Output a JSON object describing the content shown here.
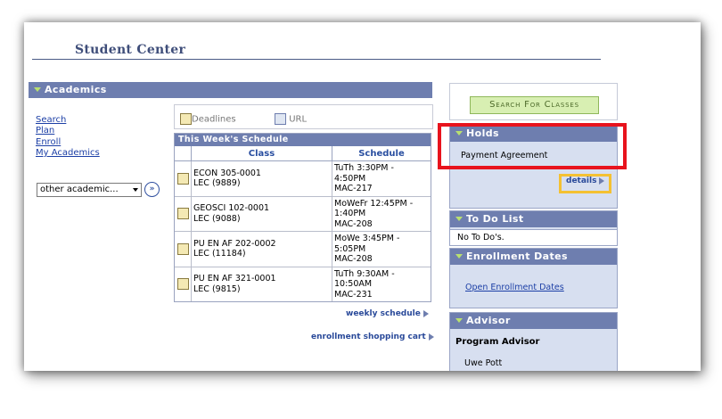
{
  "page": {
    "title": "Student Center"
  },
  "academics": {
    "header": "Academics",
    "links": [
      "Search",
      "Plan",
      "Enroll",
      "My Academics"
    ],
    "other_select": "other academic...",
    "legend": {
      "deadlines": "Deadlines",
      "url": "URL"
    },
    "schedule": {
      "title": "This Week's Schedule",
      "columns": [
        "Class",
        "Schedule"
      ],
      "rows": [
        {
          "class_line1": "ECON 305-0001",
          "class_line2": "LEC (9889)",
          "sched_line1": "TuTh 3:30PM -",
          "sched_line2": "4:50PM",
          "sched_line3": "MAC-217"
        },
        {
          "class_line1": "GEOSCI 102-0001",
          "class_line2": "LEC (9088)",
          "sched_line1": "MoWeFr 12:45PM -",
          "sched_line2": "1:40PM",
          "sched_line3": "MAC-208"
        },
        {
          "class_line1": "PU EN AF 202-0002",
          "class_line2": "LEC (11184)",
          "sched_line1": "MoWe 3:45PM -",
          "sched_line2": "5:05PM",
          "sched_line3": "MAC-208"
        },
        {
          "class_line1": "PU EN AF 321-0001",
          "class_line2": "LEC (9815)",
          "sched_line1": "TuTh 9:30AM -",
          "sched_line2": "10:50AM",
          "sched_line3": "MAC-231"
        }
      ]
    },
    "weekly_link": "weekly schedule",
    "cart_link": "enrollment shopping cart"
  },
  "right": {
    "search_button": "Search For Classes",
    "holds": {
      "header": "Holds",
      "item": "Payment Agreement",
      "details": "details"
    },
    "todo": {
      "header": "To Do List",
      "item": "No To Do's."
    },
    "enrollment_dates": {
      "header": "Enrollment Dates",
      "link": "Open Enrollment Dates"
    },
    "advisor": {
      "header": "Advisor",
      "role": "Program Advisor",
      "name": "Uwe Pott"
    }
  },
  "colors": {
    "header_bg": "#6e7eaf",
    "panel_bg": "#d7dff0",
    "highlight_red": "#e8131d",
    "highlight_yellow": "#f4c132"
  }
}
